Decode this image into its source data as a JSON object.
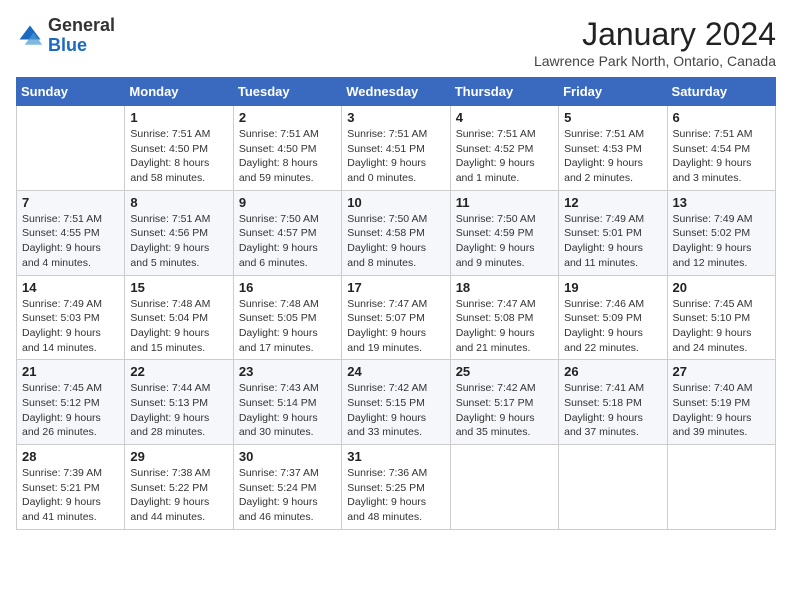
{
  "header": {
    "logo_general": "General",
    "logo_blue": "Blue",
    "month_title": "January 2024",
    "location": "Lawrence Park North, Ontario, Canada"
  },
  "days_of_week": [
    "Sunday",
    "Monday",
    "Tuesday",
    "Wednesday",
    "Thursday",
    "Friday",
    "Saturday"
  ],
  "weeks": [
    [
      {
        "day": "",
        "content": ""
      },
      {
        "day": "1",
        "content": "Sunrise: 7:51 AM\nSunset: 4:50 PM\nDaylight: 8 hours\nand 58 minutes."
      },
      {
        "day": "2",
        "content": "Sunrise: 7:51 AM\nSunset: 4:50 PM\nDaylight: 8 hours\nand 59 minutes."
      },
      {
        "day": "3",
        "content": "Sunrise: 7:51 AM\nSunset: 4:51 PM\nDaylight: 9 hours\nand 0 minutes."
      },
      {
        "day": "4",
        "content": "Sunrise: 7:51 AM\nSunset: 4:52 PM\nDaylight: 9 hours\nand 1 minute."
      },
      {
        "day": "5",
        "content": "Sunrise: 7:51 AM\nSunset: 4:53 PM\nDaylight: 9 hours\nand 2 minutes."
      },
      {
        "day": "6",
        "content": "Sunrise: 7:51 AM\nSunset: 4:54 PM\nDaylight: 9 hours\nand 3 minutes."
      }
    ],
    [
      {
        "day": "7",
        "content": "Sunrise: 7:51 AM\nSunset: 4:55 PM\nDaylight: 9 hours\nand 4 minutes."
      },
      {
        "day": "8",
        "content": "Sunrise: 7:51 AM\nSunset: 4:56 PM\nDaylight: 9 hours\nand 5 minutes."
      },
      {
        "day": "9",
        "content": "Sunrise: 7:50 AM\nSunset: 4:57 PM\nDaylight: 9 hours\nand 6 minutes."
      },
      {
        "day": "10",
        "content": "Sunrise: 7:50 AM\nSunset: 4:58 PM\nDaylight: 9 hours\nand 8 minutes."
      },
      {
        "day": "11",
        "content": "Sunrise: 7:50 AM\nSunset: 4:59 PM\nDaylight: 9 hours\nand 9 minutes."
      },
      {
        "day": "12",
        "content": "Sunrise: 7:49 AM\nSunset: 5:01 PM\nDaylight: 9 hours\nand 11 minutes."
      },
      {
        "day": "13",
        "content": "Sunrise: 7:49 AM\nSunset: 5:02 PM\nDaylight: 9 hours\nand 12 minutes."
      }
    ],
    [
      {
        "day": "14",
        "content": "Sunrise: 7:49 AM\nSunset: 5:03 PM\nDaylight: 9 hours\nand 14 minutes."
      },
      {
        "day": "15",
        "content": "Sunrise: 7:48 AM\nSunset: 5:04 PM\nDaylight: 9 hours\nand 15 minutes."
      },
      {
        "day": "16",
        "content": "Sunrise: 7:48 AM\nSunset: 5:05 PM\nDaylight: 9 hours\nand 17 minutes."
      },
      {
        "day": "17",
        "content": "Sunrise: 7:47 AM\nSunset: 5:07 PM\nDaylight: 9 hours\nand 19 minutes."
      },
      {
        "day": "18",
        "content": "Sunrise: 7:47 AM\nSunset: 5:08 PM\nDaylight: 9 hours\nand 21 minutes."
      },
      {
        "day": "19",
        "content": "Sunrise: 7:46 AM\nSunset: 5:09 PM\nDaylight: 9 hours\nand 22 minutes."
      },
      {
        "day": "20",
        "content": "Sunrise: 7:45 AM\nSunset: 5:10 PM\nDaylight: 9 hours\nand 24 minutes."
      }
    ],
    [
      {
        "day": "21",
        "content": "Sunrise: 7:45 AM\nSunset: 5:12 PM\nDaylight: 9 hours\nand 26 minutes."
      },
      {
        "day": "22",
        "content": "Sunrise: 7:44 AM\nSunset: 5:13 PM\nDaylight: 9 hours\nand 28 minutes."
      },
      {
        "day": "23",
        "content": "Sunrise: 7:43 AM\nSunset: 5:14 PM\nDaylight: 9 hours\nand 30 minutes."
      },
      {
        "day": "24",
        "content": "Sunrise: 7:42 AM\nSunset: 5:15 PM\nDaylight: 9 hours\nand 33 minutes."
      },
      {
        "day": "25",
        "content": "Sunrise: 7:42 AM\nSunset: 5:17 PM\nDaylight: 9 hours\nand 35 minutes."
      },
      {
        "day": "26",
        "content": "Sunrise: 7:41 AM\nSunset: 5:18 PM\nDaylight: 9 hours\nand 37 minutes."
      },
      {
        "day": "27",
        "content": "Sunrise: 7:40 AM\nSunset: 5:19 PM\nDaylight: 9 hours\nand 39 minutes."
      }
    ],
    [
      {
        "day": "28",
        "content": "Sunrise: 7:39 AM\nSunset: 5:21 PM\nDaylight: 9 hours\nand 41 minutes."
      },
      {
        "day": "29",
        "content": "Sunrise: 7:38 AM\nSunset: 5:22 PM\nDaylight: 9 hours\nand 44 minutes."
      },
      {
        "day": "30",
        "content": "Sunrise: 7:37 AM\nSunset: 5:24 PM\nDaylight: 9 hours\nand 46 minutes."
      },
      {
        "day": "31",
        "content": "Sunrise: 7:36 AM\nSunset: 5:25 PM\nDaylight: 9 hours\nand 48 minutes."
      },
      {
        "day": "",
        "content": ""
      },
      {
        "day": "",
        "content": ""
      },
      {
        "day": "",
        "content": ""
      }
    ]
  ]
}
